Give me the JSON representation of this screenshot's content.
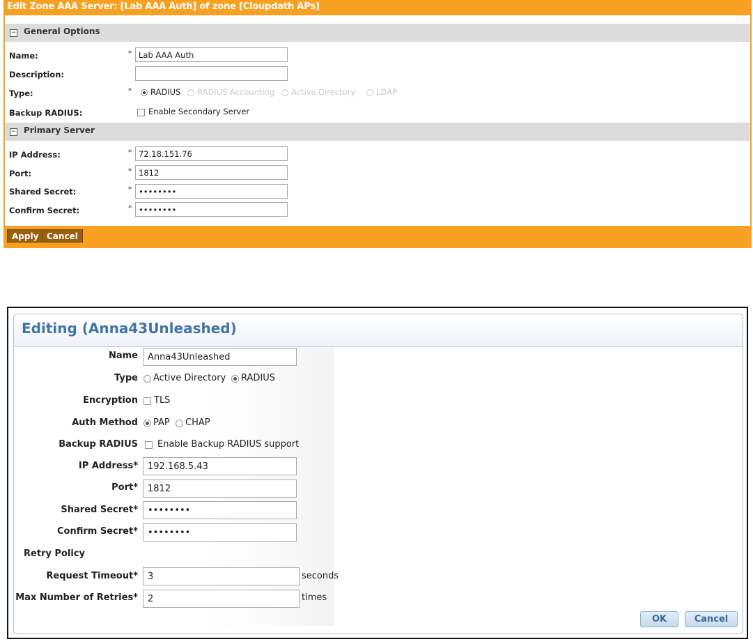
{
  "panel1": {
    "title": "Edit Zone AAA Server: [Lab AAA Auth] of zone [Cloupdath APs]",
    "sections": {
      "general": "General Options",
      "primary": "Primary Server"
    },
    "collapse_glyph": "−",
    "required_mark": "*",
    "labels": {
      "name": "Name:",
      "description": "Description:",
      "type": "Type:",
      "backup": "Backup RADIUS:",
      "ip": "IP Address:",
      "port": "Port:",
      "secret": "Shared Secret:",
      "confirm": "Confirm Secret:"
    },
    "values": {
      "name": "Lab AAA Auth",
      "description": "",
      "ip": "72.18.151.76",
      "port": "1812",
      "secret": "••••••••",
      "confirm": "••••••••"
    },
    "type_options": [
      "RADIUS",
      "RADIUS Accounting",
      "Active Directory",
      "LDAP"
    ],
    "type_selected": "RADIUS",
    "backup_checkbox_label": "Enable Secondary Server",
    "backup_checked": false,
    "buttons": {
      "apply": "Apply",
      "cancel": "Cancel"
    },
    "colors": {
      "frame": "#f7a021",
      "button": "#9a5f0c",
      "section": "#dcdcdc"
    }
  },
  "panel2": {
    "title": "Editing (Anna43Unleashed)",
    "labels": {
      "name": "Name",
      "type": "Type",
      "encryption": "Encryption",
      "auth": "Auth Method",
      "backup": "Backup RADIUS",
      "ip": "IP Address*",
      "port": "Port*",
      "secret": "Shared Secret*",
      "confirm": "Confirm Secret*",
      "retry": "Retry Policy",
      "timeout": "Request Timeout*",
      "retries": "Max Number of Retries*"
    },
    "values": {
      "name": "Anna43Unleashed",
      "ip": "192.168.5.43",
      "port": "1812",
      "secret": "••••••••",
      "confirm": "••••••••",
      "timeout": "3",
      "retries": "2"
    },
    "type_options": [
      "Active Directory",
      "RADIUS"
    ],
    "type_selected": "RADIUS",
    "encryption_label": "TLS",
    "encryption_checked": false,
    "auth_options": [
      "PAP",
      "CHAP"
    ],
    "auth_selected": "PAP",
    "backup_checkbox_label": "Enable Backup RADIUS support",
    "backup_checked": false,
    "units": {
      "timeout": "seconds",
      "retries": "times"
    },
    "buttons": {
      "ok": "OK",
      "cancel": "Cancel"
    },
    "colors": {
      "title": "#4474a6",
      "border": "#a9c2d8",
      "button_text": "#3a6b9c"
    }
  }
}
